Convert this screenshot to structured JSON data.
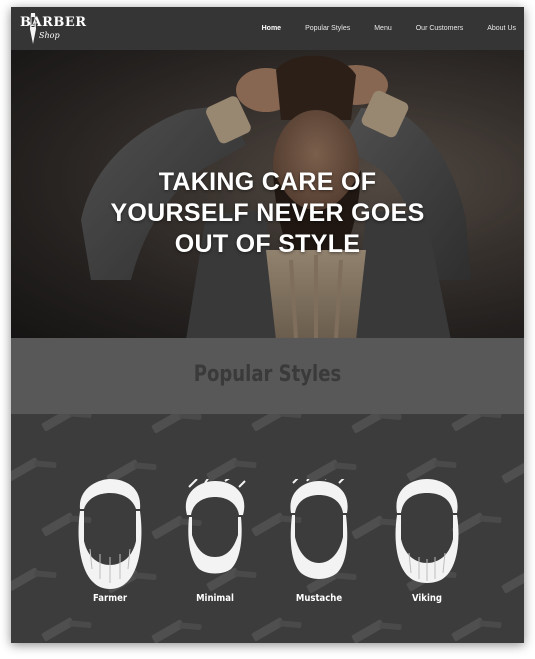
{
  "brand": {
    "name_top": "BARBER",
    "name_sub": "Shop"
  },
  "nav": {
    "items": [
      {
        "label": "Home",
        "active": true
      },
      {
        "label": "Popular Styles",
        "active": false
      },
      {
        "label": "Menu",
        "active": false
      },
      {
        "label": "Our Customers",
        "active": false
      },
      {
        "label": "About Us",
        "active": false
      }
    ]
  },
  "hero": {
    "line1": "TAKING CARE OF",
    "line2": "YOURSELF NEVER GOES",
    "line3": "OUT OF STYLE"
  },
  "popular": {
    "title": "Popular Styles",
    "styles": [
      {
        "label": "Farmer"
      },
      {
        "label": "Minimal"
      },
      {
        "label": "Mustache"
      },
      {
        "label": "Viking"
      }
    ]
  },
  "colors": {
    "nav_bg": "#353535",
    "section_header_bg": "#585858",
    "grid_bg": "#3c3c3c",
    "text": "#ffffff"
  },
  "icons": [
    "razor-icon",
    "beard-illustration"
  ]
}
